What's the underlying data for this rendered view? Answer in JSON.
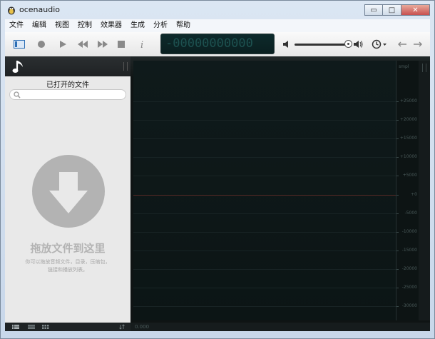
{
  "window": {
    "title": "ocenaudio",
    "minimize_glyph": "▭",
    "maximize_glyph": "□",
    "close_glyph": "✕"
  },
  "menu": [
    "文件",
    "编辑",
    "视图",
    "控制",
    "效果器",
    "生成",
    "分析",
    "帮助"
  ],
  "toolbar": {
    "counter_display": "-00000000000",
    "icons": [
      "sidebar-toggle-icon",
      "record-icon",
      "play-icon",
      "rewind-icon",
      "fast-forward-icon",
      "stop-icon",
      "info-icon",
      "volume-low-icon",
      "volume-high-icon",
      "clock-icon",
      "back-arrow-icon",
      "forward-arrow-icon"
    ],
    "volume_level": 0.95
  },
  "sidebar": {
    "title": "已打开的文件",
    "search_placeholder": "",
    "drop_title": "拖放文件到这里",
    "drop_subtitle": "你可以拖放音频文件，目录，压缩包，链接和播放列表。"
  },
  "waveform": {
    "scale_unit": "smpl",
    "ticks": [
      "+25000",
      "+20000",
      "+15000",
      "+10000",
      "+5000",
      "+0",
      "-5000",
      "-10000",
      "-15000",
      "-20000",
      "-25000",
      "-30000"
    ],
    "time_readout": "0.000"
  },
  "colors": {
    "accent": "#2d6fb5",
    "zero_line": "#5a2a26",
    "lcd_text": "#1d5150"
  }
}
